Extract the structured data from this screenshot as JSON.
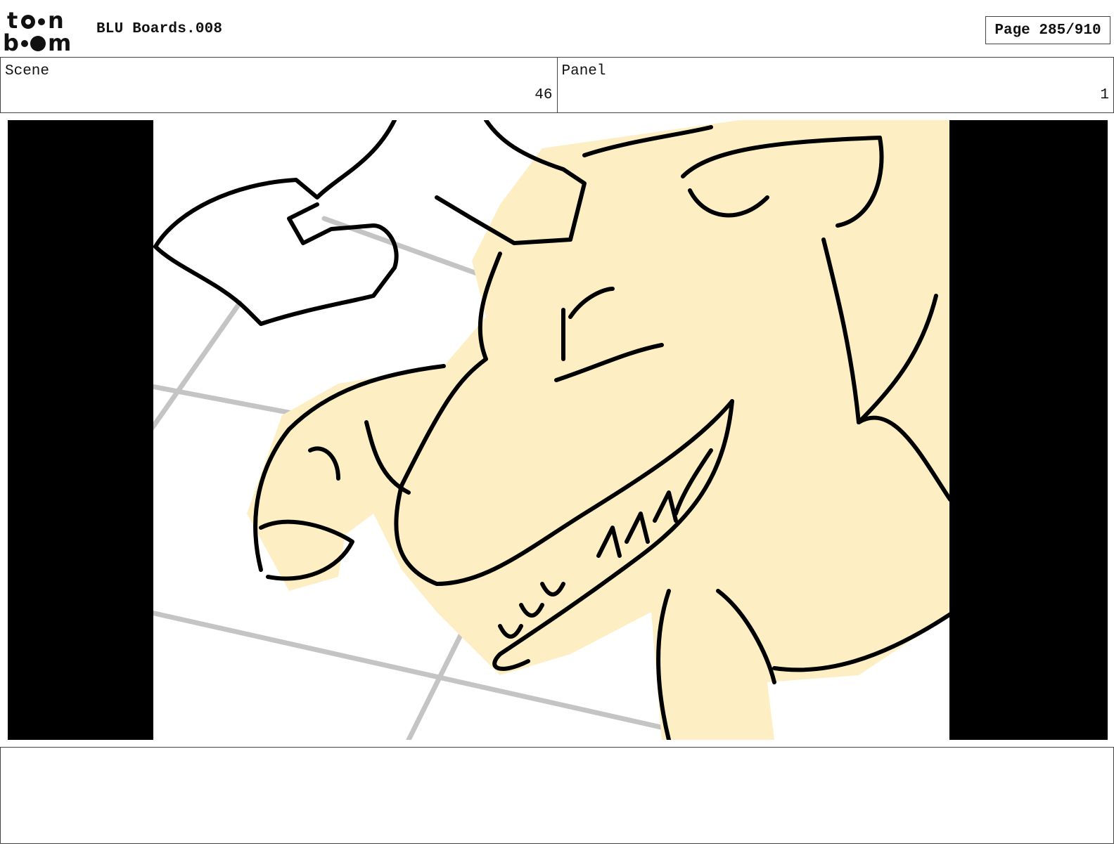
{
  "header": {
    "logo_text": "toon boom",
    "title": "BLU Boards.008",
    "page_label": "Page 285/910"
  },
  "info": {
    "scene_label": "Scene",
    "scene_value": "46",
    "panel_label": "Panel",
    "panel_value": "1"
  },
  "notes": {
    "text": ""
  },
  "colors": {
    "skin": "#fdeec4",
    "ink": "#000000",
    "floor_lines": "#c4c4c4",
    "letterbox": "#000000"
  }
}
